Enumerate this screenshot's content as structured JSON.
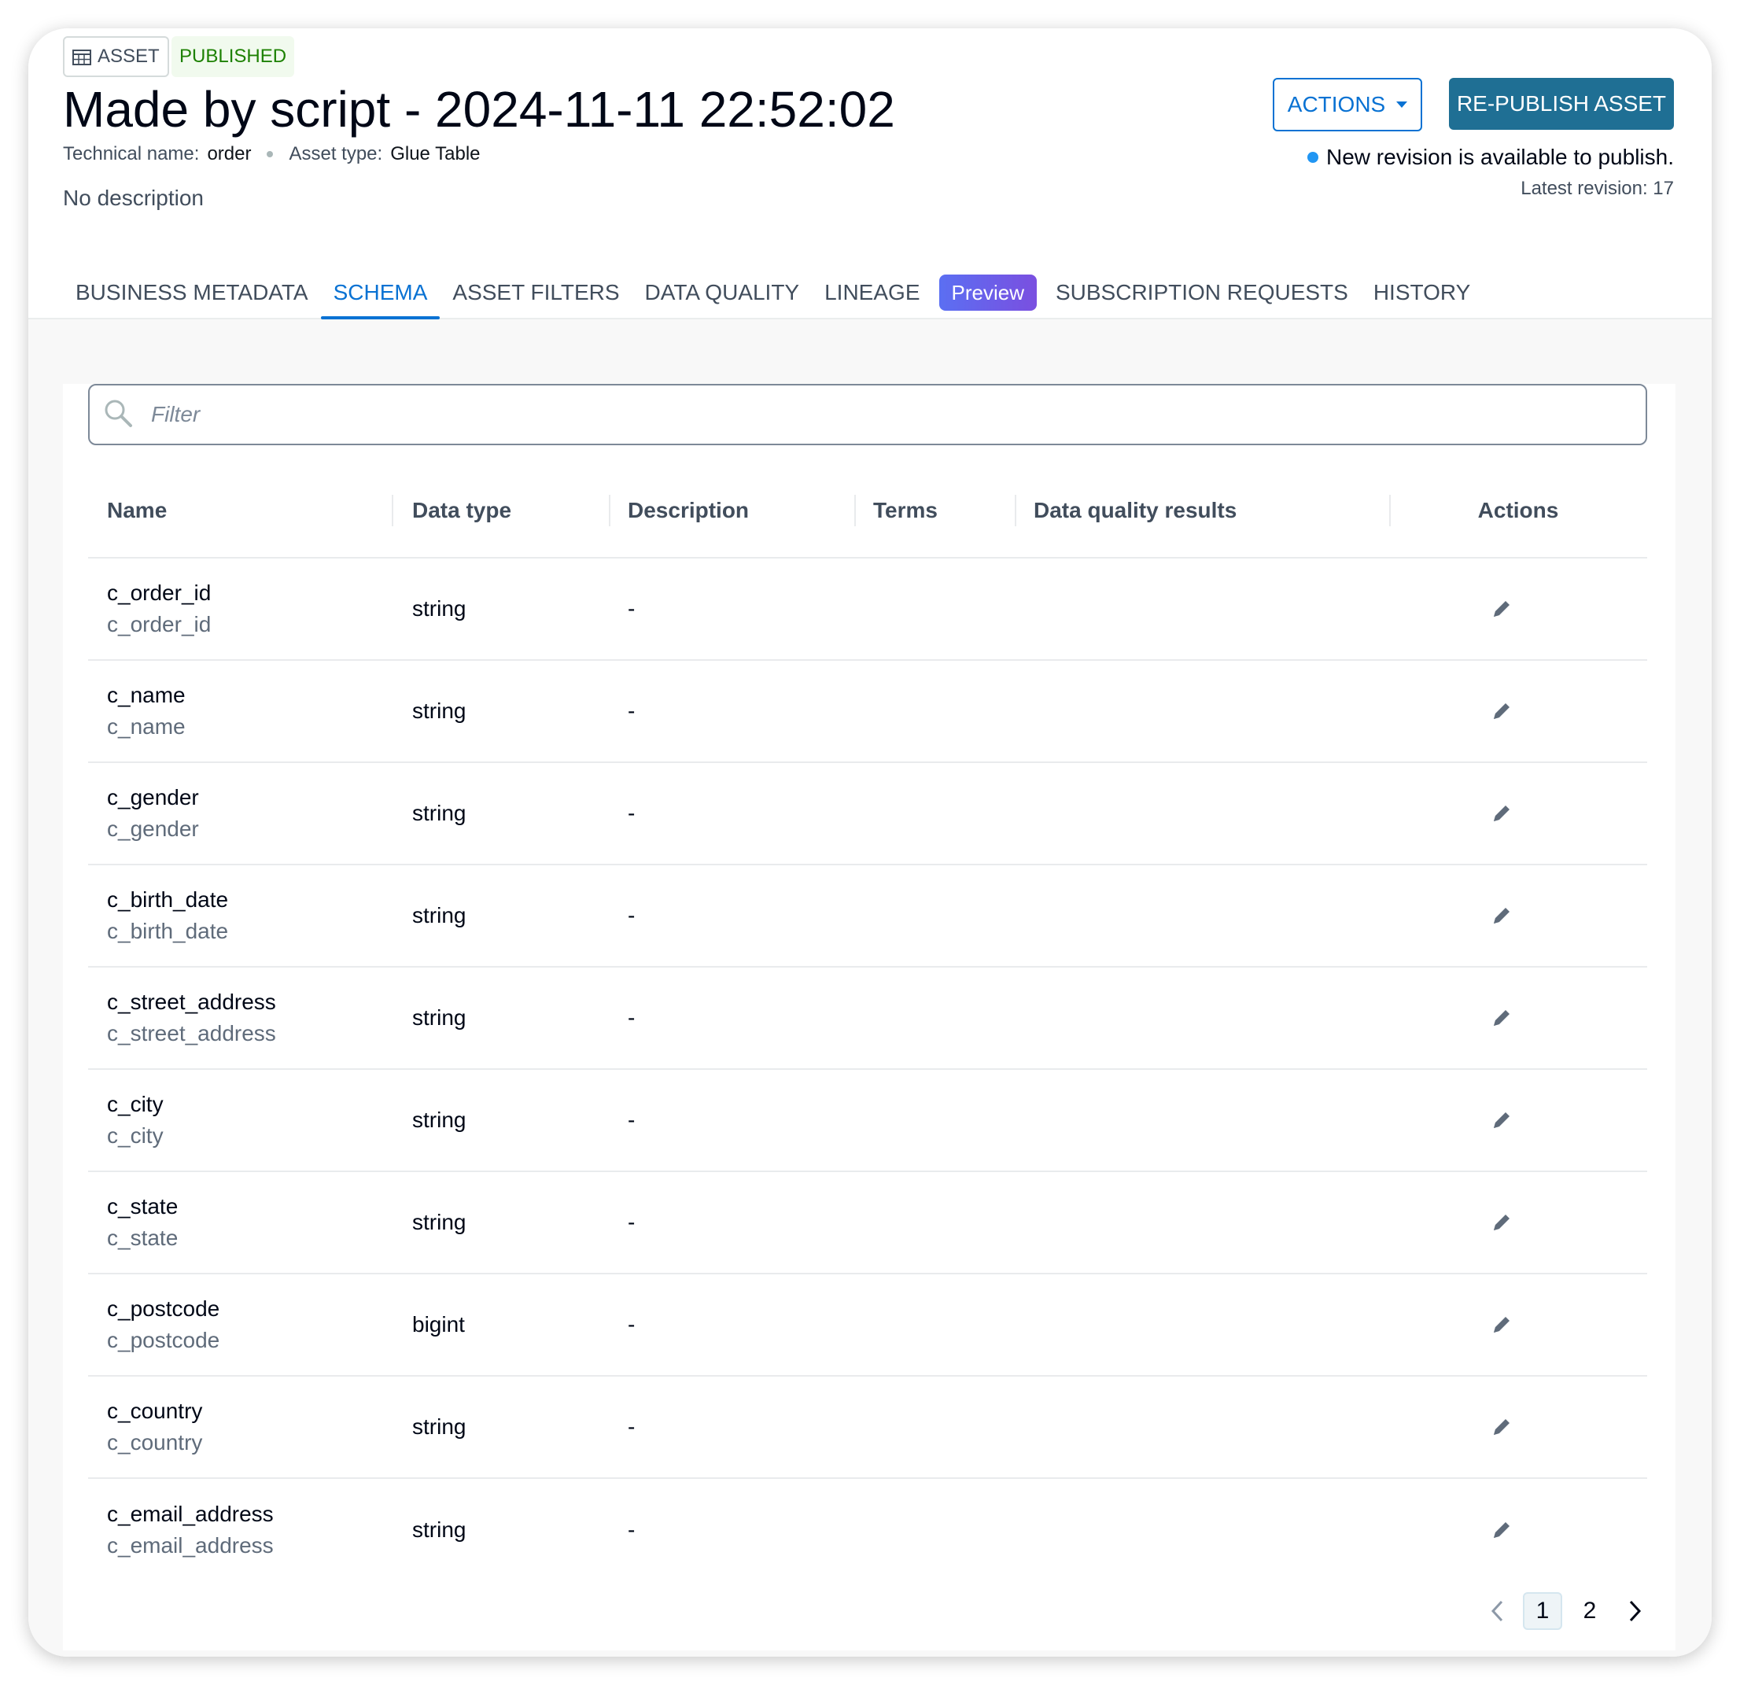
{
  "asset": {
    "type_badge": "ASSET",
    "status_badge": "PUBLISHED",
    "title": "Made by script - 2024-11-11 22:52:02",
    "technical_name_label": "Technical name:",
    "technical_name": "order",
    "asset_type_label": "Asset type:",
    "asset_type": "Glue Table",
    "description": "No description"
  },
  "header_actions": {
    "actions_label": "ACTIONS",
    "republish_label": "RE-PUBLISH ASSET",
    "revision_note": "New revision is available to publish.",
    "latest_revision": "Latest revision: 17"
  },
  "tabs": [
    {
      "label": "BUSINESS METADATA",
      "active": false
    },
    {
      "label": "SCHEMA",
      "active": true
    },
    {
      "label": "ASSET FILTERS",
      "active": false
    },
    {
      "label": "DATA QUALITY",
      "active": false
    },
    {
      "label": "LINEAGE",
      "active": false
    },
    {
      "label": "SUBSCRIPTION REQUESTS",
      "active": false
    },
    {
      "label": "HISTORY",
      "active": false
    }
  ],
  "preview_badge": "Preview",
  "filter": {
    "placeholder": "Filter",
    "value": ""
  },
  "table": {
    "columns": [
      "Name",
      "Data type",
      "Description",
      "Terms",
      "Data quality results",
      "Actions"
    ],
    "rows": [
      {
        "name": "c_order_id",
        "technical": "c_order_id",
        "type": "string",
        "description": "-"
      },
      {
        "name": "c_name",
        "technical": "c_name",
        "type": "string",
        "description": "-"
      },
      {
        "name": "c_gender",
        "technical": "c_gender",
        "type": "string",
        "description": "-"
      },
      {
        "name": "c_birth_date",
        "technical": "c_birth_date",
        "type": "string",
        "description": "-"
      },
      {
        "name": "c_street_address",
        "technical": "c_street_address",
        "type": "string",
        "description": "-"
      },
      {
        "name": "c_city",
        "technical": "c_city",
        "type": "string",
        "description": "-"
      },
      {
        "name": "c_state",
        "technical": "c_state",
        "type": "string",
        "description": "-"
      },
      {
        "name": "c_postcode",
        "technical": "c_postcode",
        "type": "bigint",
        "description": "-"
      },
      {
        "name": "c_country",
        "technical": "c_country",
        "type": "string",
        "description": "-"
      },
      {
        "name": "c_email_address",
        "technical": "c_email_address",
        "type": "string",
        "description": "-"
      }
    ]
  },
  "pagination": {
    "pages": [
      "1",
      "2"
    ],
    "current": "1"
  },
  "icons": {
    "badge": "table-icon",
    "filter": "search-icon",
    "row_action": "pencil-edit-icon",
    "prev": "chevron-left-icon",
    "next": "chevron-right-icon",
    "revision_indicator": "blue-dot-icon"
  },
  "colors": {
    "accent": "#0972d3",
    "primary_button": "#1f6f94",
    "published": "#1d8102",
    "indicator": "#2196f3"
  }
}
